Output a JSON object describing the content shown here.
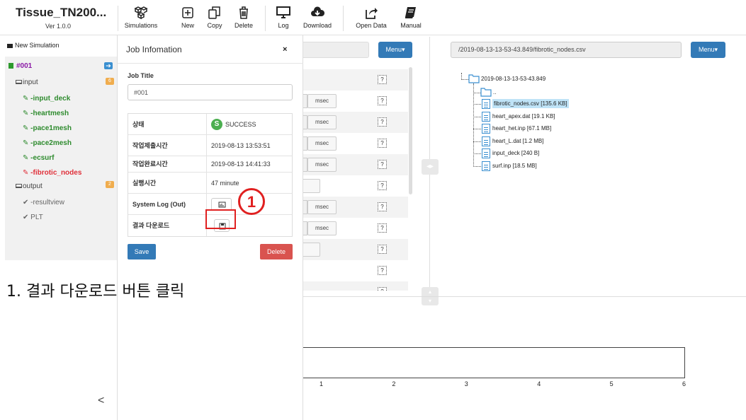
{
  "app": {
    "title": "Tissue_TN200...",
    "version": "Ver 1.0.0"
  },
  "toolbar": [
    {
      "label": "Simulations",
      "icon": "cubes-icon"
    },
    {
      "label": "New",
      "icon": "plus-square-icon"
    },
    {
      "label": "Copy",
      "icon": "copy-icon"
    },
    {
      "label": "Delete",
      "icon": "trash-icon"
    },
    {
      "label": "Log",
      "icon": "monitor-icon"
    },
    {
      "label": "Download",
      "icon": "cloud-download-icon"
    },
    {
      "label": "Open Data",
      "icon": "share-icon"
    },
    {
      "label": "Manual",
      "icon": "book-icon"
    }
  ],
  "sidebar": {
    "new_simulation": "New Simulation",
    "job": "#001",
    "input": {
      "label": "input",
      "badge": "6"
    },
    "input_items": [
      "-input_deck",
      "-heartmesh",
      "-pace1mesh",
      "-pace2mesh",
      "-ecsurf",
      "-fibrotic_nodes"
    ],
    "output": {
      "label": "output",
      "badge": "2"
    },
    "output_items": [
      "-resultview",
      "PLT"
    ],
    "collapse": "<"
  },
  "job_panel": {
    "title": "Job Infomation",
    "close": "×",
    "job_title_label": "Job Title",
    "job_title_value": "#001",
    "rows": [
      {
        "key": "상태",
        "value": "SUCCESS",
        "badge": "S"
      },
      {
        "key": "작업제출시간",
        "value": "2019-08-13 13:53:51"
      },
      {
        "key": "작업완료시간",
        "value": "2019-08-13 14:41:33"
      },
      {
        "key": "실행시간",
        "value": "47 minute"
      },
      {
        "key": "System Log (Out)",
        "value": ""
      },
      {
        "key": "결과 다운로드",
        "value": ""
      }
    ],
    "save": "Save",
    "delete": "Delete"
  },
  "annotation": {
    "marker": "1",
    "instruction": "1. 결과 다운로드 버튼 클릭"
  },
  "middle": {
    "menu": "Menu▾",
    "rows": [
      {
        "type": "none",
        "q": "?"
      },
      {
        "type": "msec",
        "unit": "msec",
        "q": "?"
      },
      {
        "type": "msec",
        "unit": "msec",
        "q": "?"
      },
      {
        "type": "msec",
        "unit": "msec",
        "q": "?"
      },
      {
        "type": "msec",
        "unit": "msec",
        "q": "?"
      },
      {
        "type": "blank",
        "q": "?"
      },
      {
        "type": "msec",
        "unit": "msec",
        "q": "?"
      },
      {
        "type": "msec",
        "unit": "msec",
        "q": "?"
      },
      {
        "type": "blank",
        "q": "?"
      },
      {
        "type": "none",
        "q": "?"
      },
      {
        "type": "none",
        "q": "?"
      }
    ]
  },
  "files": {
    "path": "/2019-08-13-13-53-43.849/fibrotic_nodes.csv",
    "menu": "Menu▾",
    "root": "2019-08-13-13-53-43.849",
    "parent": "..",
    "items": [
      {
        "name": "fibrotic_nodes.csv [135.6 KB]",
        "selected": true
      },
      {
        "name": "heart_apex.dat [19.1 KB]",
        "selected": false
      },
      {
        "name": "heart_het.inp [67.1 MB]",
        "selected": false
      },
      {
        "name": "heart_L.dat [1.2 MB]",
        "selected": false
      },
      {
        "name": "input_deck [240 B]",
        "selected": false
      },
      {
        "name": "surf.inp [18.5 MB]",
        "selected": false
      }
    ]
  },
  "chart": {
    "x_ticks": [
      "1",
      "2",
      "3",
      "4",
      "5",
      "6"
    ]
  },
  "colors": {
    "primary": "#337ab7",
    "danger": "#d9534f",
    "success": "#4caf50",
    "annotation": "#e02020"
  }
}
